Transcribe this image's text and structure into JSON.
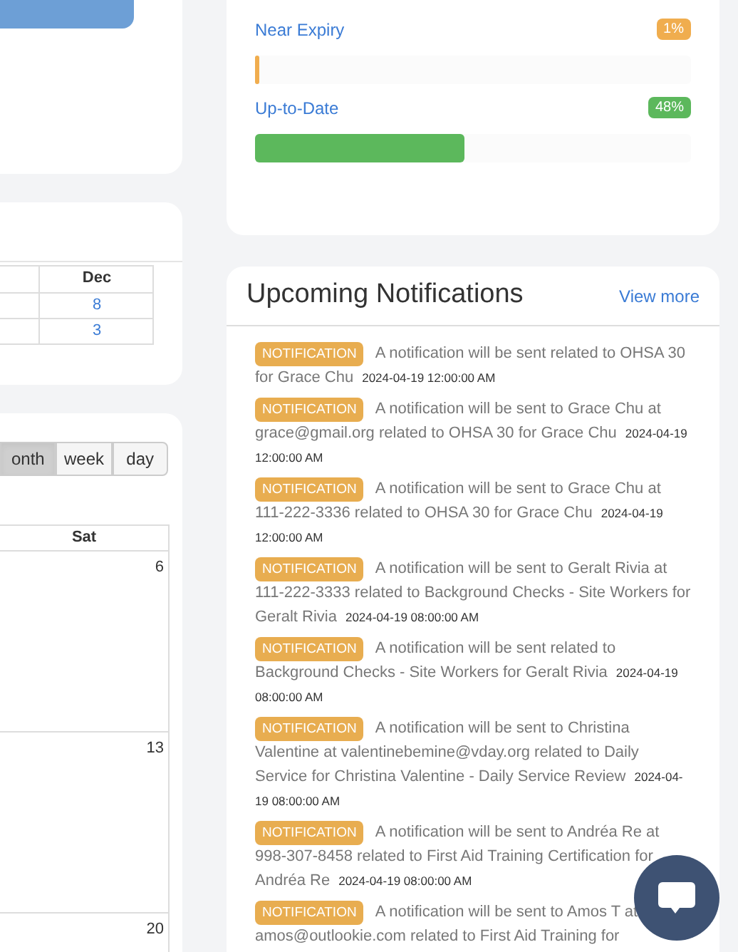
{
  "month_table": {
    "columns": [
      "Dec"
    ],
    "rows": [
      [
        "8"
      ],
      [
        "3"
      ]
    ]
  },
  "calendar": {
    "views": [
      {
        "label": "onth",
        "selected": true
      },
      {
        "label": "week",
        "selected": false
      },
      {
        "label": "day",
        "selected": false
      }
    ],
    "day_header": "Sat",
    "days": [
      "6",
      "13",
      "20"
    ]
  },
  "status": [
    {
      "label": "Near Expiry",
      "percent": "1%",
      "level": 0.01,
      "color": "#f0ad4e"
    },
    {
      "label": "Up-to-Date",
      "percent": "48%",
      "level": 0.48,
      "color": "#5cb85c"
    }
  ],
  "notifications": {
    "title": "Upcoming Notifications",
    "view_more": "View more",
    "items": [
      {
        "badge": "NOTIFICATION",
        "message": "A notification will be sent related to OHSA 30 for Grace Chu",
        "time": "2024-04-19 12:00:00 AM"
      },
      {
        "badge": "NOTIFICATION",
        "message": "A notification will be sent to Grace Chu at grace@gmail.org related to OHSA 30 for Grace Chu",
        "time": "2024-04-19 12:00:00 AM"
      },
      {
        "badge": "NOTIFICATION",
        "message": "A notification will be sent to Grace Chu at 111-222-3336 related to OHSA 30 for Grace Chu",
        "time": "2024-04-19 12:00:00 AM"
      },
      {
        "badge": "NOTIFICATION",
        "message": "A notification will be sent to Geralt Rivia at 111-222-3333 related to Background Checks - Site Workers for Geralt Rivia",
        "time": "2024-04-19 08:00:00 AM"
      },
      {
        "badge": "NOTIFICATION",
        "message": "A notification will be sent related to Background Checks - Site Workers for Geralt Rivia",
        "time": "2024-04-19 08:00:00 AM"
      },
      {
        "badge": "NOTIFICATION",
        "message": "A notification will be sent to Christina Valentine at valentinebemine@vday.org related to Daily Service for Christina Valentine - Daily Service Review",
        "time": "2024-04-19 08:00:00 AM"
      },
      {
        "badge": "NOTIFICATION",
        "message": "A notification will be sent to Andréa Re at 998-307-8458 related to First Aid Training Certification for Andréa Re",
        "time": "2024-04-19 08:00:00 AM"
      },
      {
        "badge": "NOTIFICATION",
        "message": "A notification will be sent to Amos T at amos@outlookie.com related to First Aid Training for"
      }
    ]
  }
}
